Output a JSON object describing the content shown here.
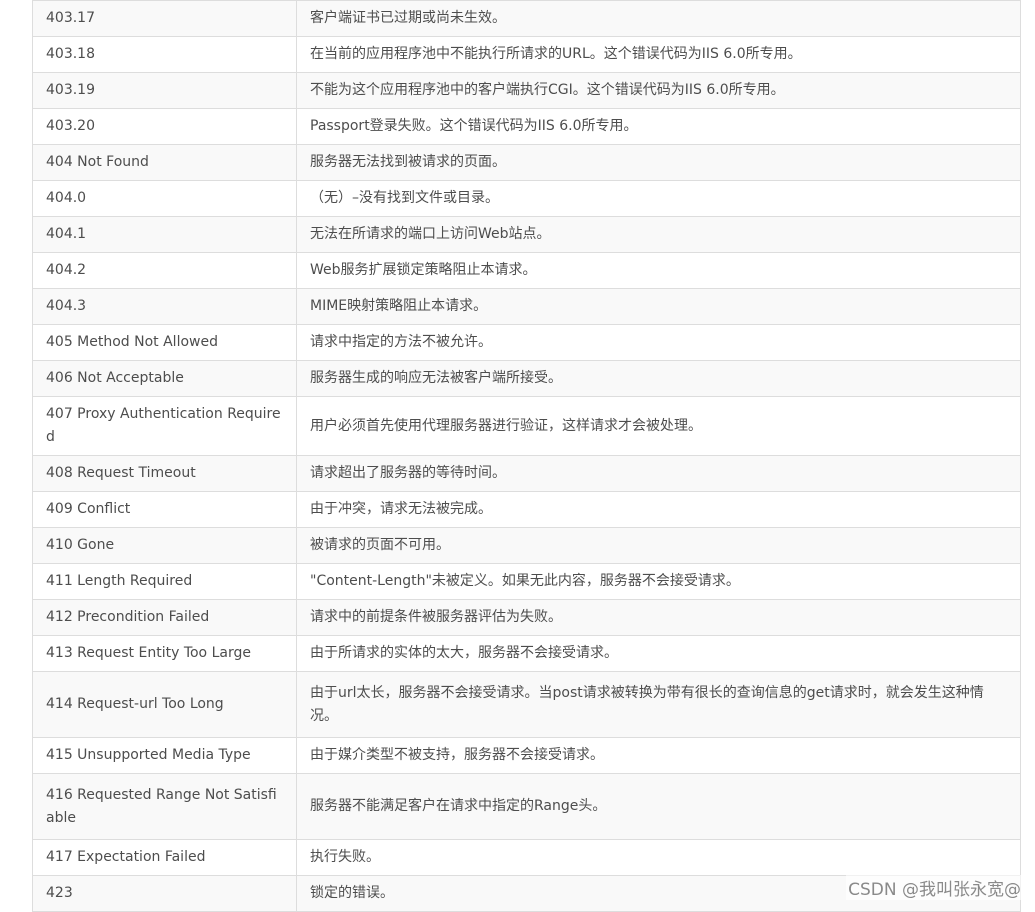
{
  "rows": [
    {
      "code": "403.17",
      "desc": "客户端证书已过期或尚未生效。"
    },
    {
      "code": "403.18",
      "desc": "在当前的应用程序池中不能执行所请求的URL。这个错误代码为IIS 6.0所专用。"
    },
    {
      "code": "403.19",
      "desc": "不能为这个应用程序池中的客户端执行CGI。这个错误代码为IIS 6.0所专用。"
    },
    {
      "code": "403.20",
      "desc": "Passport登录失败。这个错误代码为IIS 6.0所专用。"
    },
    {
      "code": "404 Not Found",
      "desc": "服务器无法找到被请求的页面。"
    },
    {
      "code": "404.0",
      "desc": "（无）–没有找到文件或目录。"
    },
    {
      "code": "404.1",
      "desc": "无法在所请求的端口上访问Web站点。"
    },
    {
      "code": "404.2",
      "desc": "Web服务扩展锁定策略阻止本请求。"
    },
    {
      "code": "404.3",
      "desc": "MIME映射策略阻止本请求。"
    },
    {
      "code": "405 Method Not Allowed",
      "desc": "请求中指定的方法不被允许。"
    },
    {
      "code": "406 Not Acceptable",
      "desc": "服务器生成的响应无法被客户端所接受。"
    },
    {
      "code": "407 Proxy Authentication Required",
      "desc": "用户必须首先使用代理服务器进行验证，这样请求才会被处理。"
    },
    {
      "code": "408 Request Timeout",
      "desc": "请求超出了服务器的等待时间。"
    },
    {
      "code": "409 Conflict",
      "desc": "由于冲突，请求无法被完成。"
    },
    {
      "code": "410 Gone",
      "desc": "被请求的页面不可用。"
    },
    {
      "code": "411 Length Required",
      "desc": "\"Content-Length\"未被定义。如果无此内容，服务器不会接受请求。"
    },
    {
      "code": "412 Precondition Failed",
      "desc": "请求中的前提条件被服务器评估为失败。"
    },
    {
      "code": "413 Request Entity Too Large",
      "desc": "由于所请求的实体的太大，服务器不会接受请求。"
    },
    {
      "code": "414 Request-url Too Long",
      "desc": "由于url太长，服务器不会接受请求。当post请求被转换为带有很长的查询信息的get请求时，就会发生这种情况。"
    },
    {
      "code": "415 Unsupported Media Type",
      "desc": "由于媒介类型不被支持，服务器不会接受请求。"
    },
    {
      "code": "416 Requested Range Not Satisfiable",
      "desc": "服务器不能满足客户在请求中指定的Range头。"
    },
    {
      "code": "417 Expectation Failed",
      "desc": "执行失败。"
    },
    {
      "code": "423",
      "desc": "锁定的错误。"
    }
  ],
  "watermark": "CSDN @我叫张永宽@"
}
